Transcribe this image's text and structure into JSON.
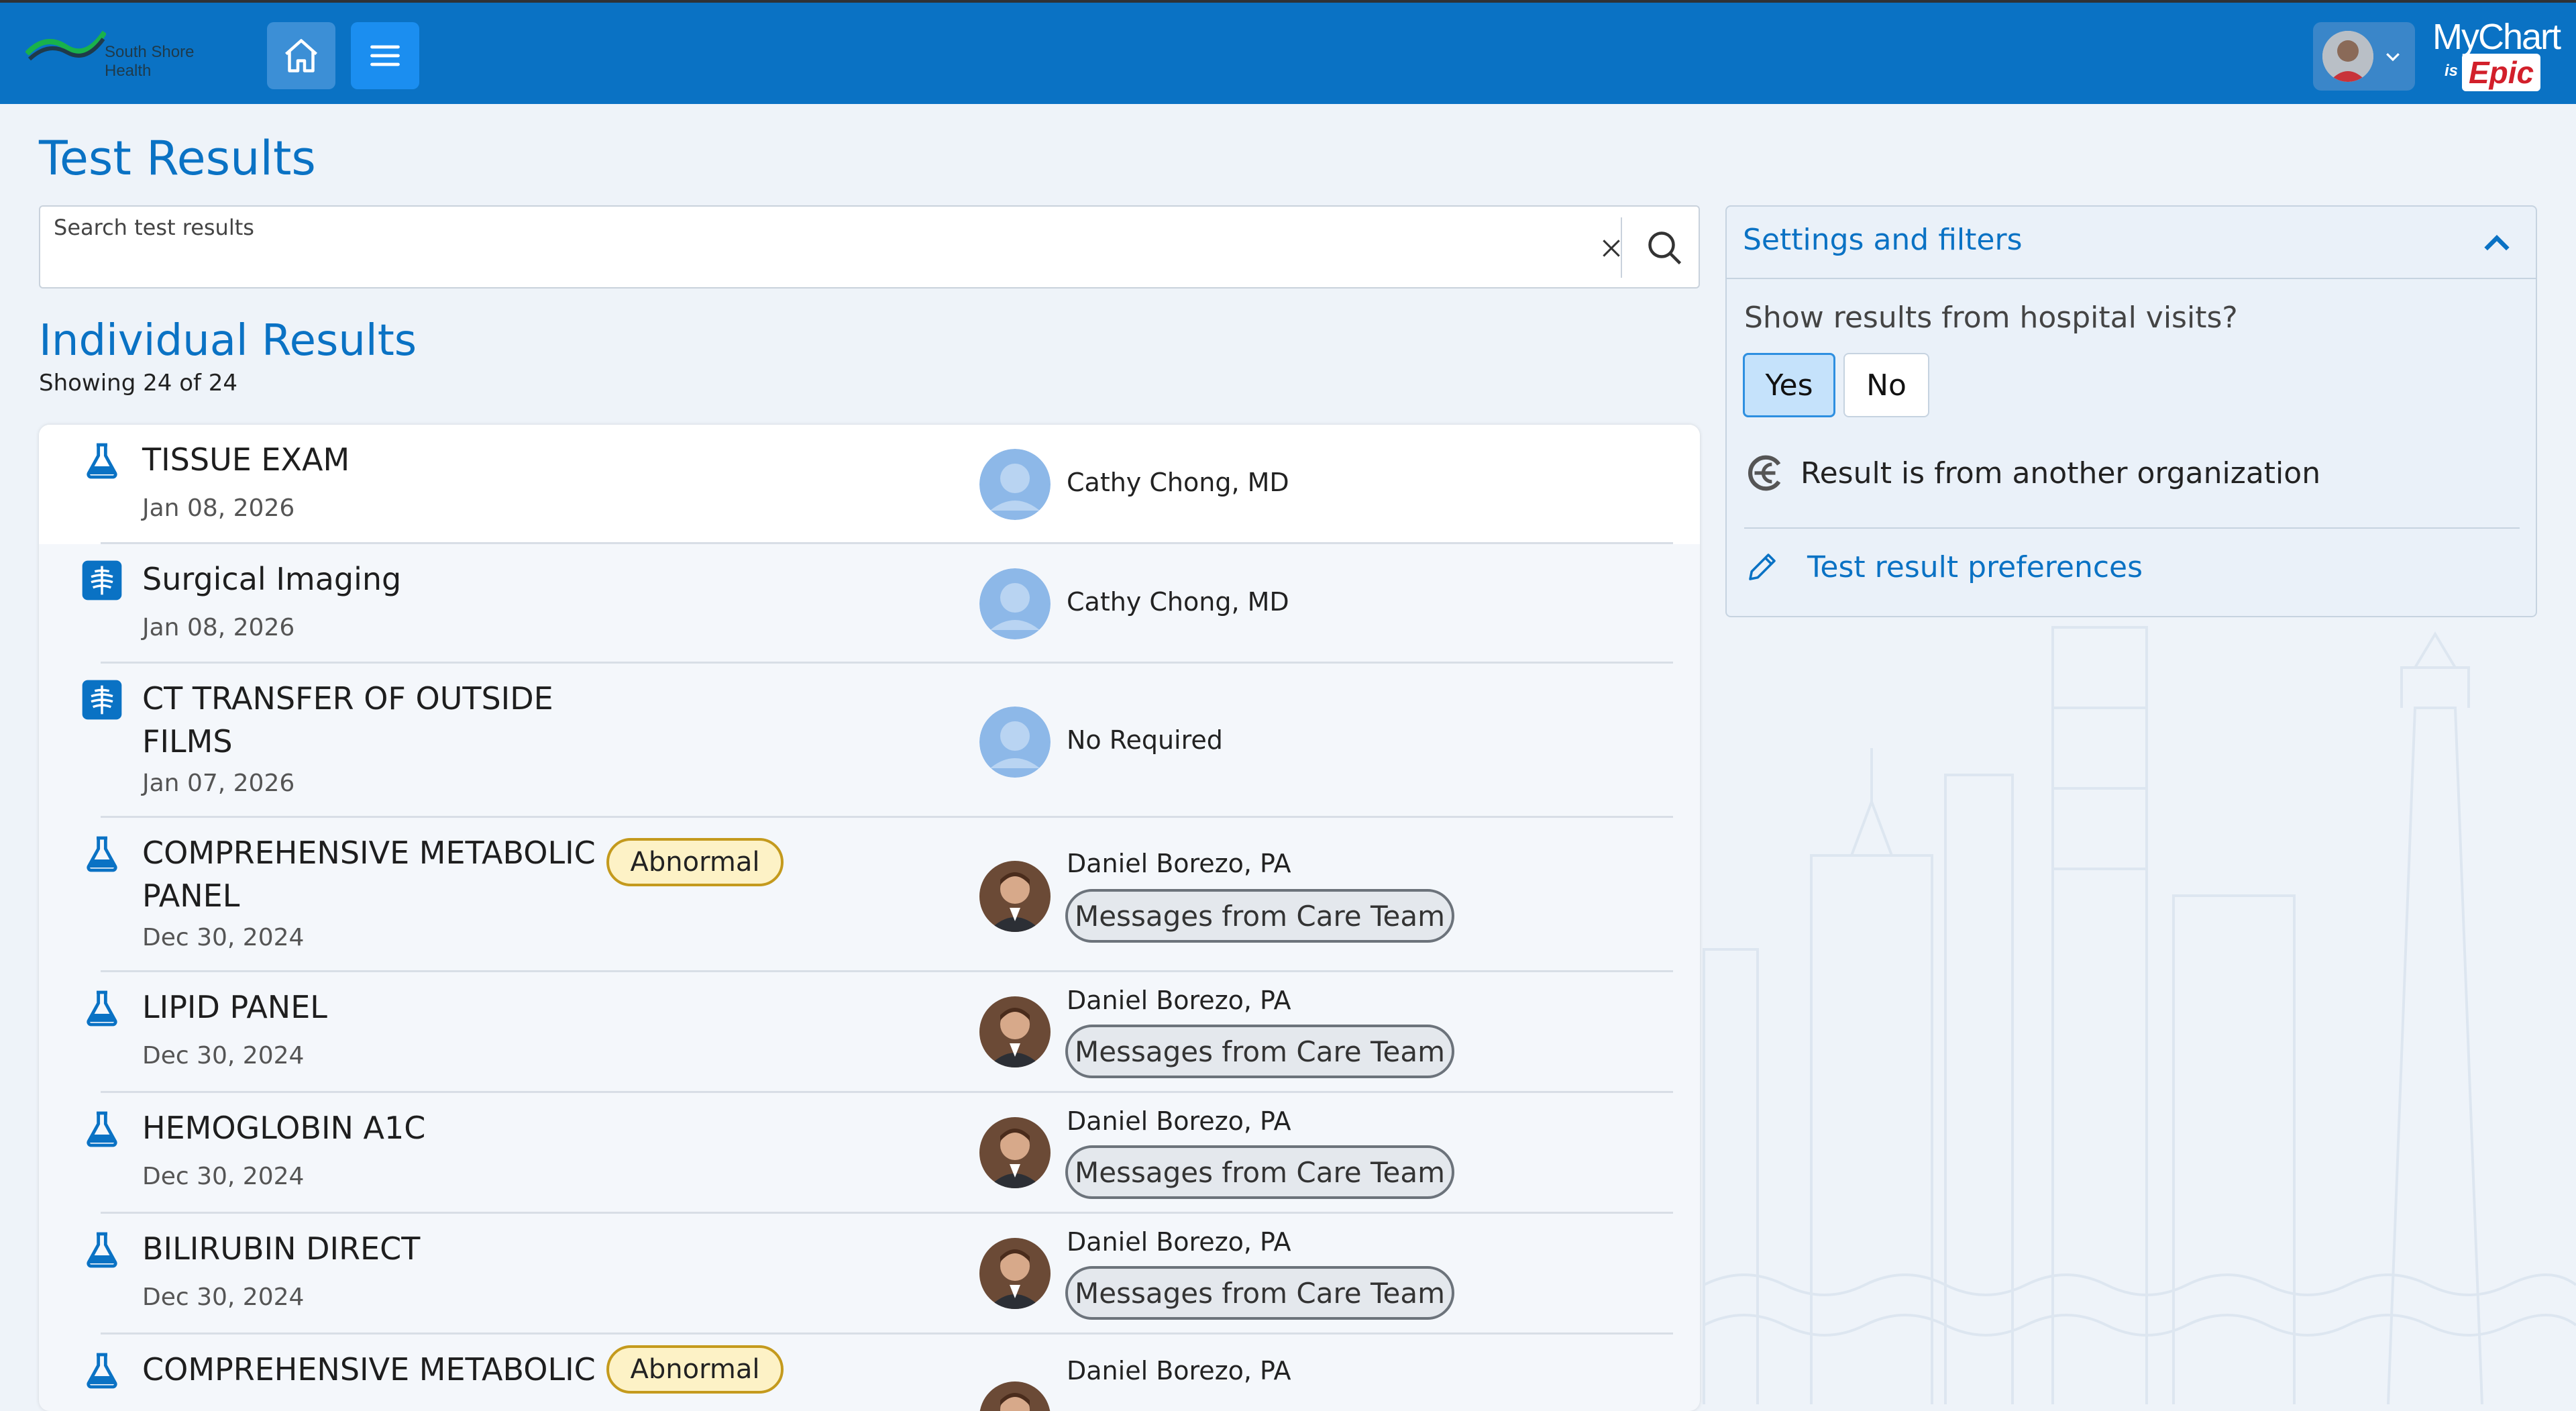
{
  "header": {
    "logo_text_line1": "South Shore",
    "logo_text_line2": "Health",
    "brand_mychart": "MyChart",
    "brand_is": "is",
    "brand_epic": "Epic"
  },
  "page": {
    "title": "Test Results",
    "search_placeholder": "Search test results",
    "section_title": "Individual Results",
    "showing": "Showing 24 of 24"
  },
  "results": [
    {
      "icon": "flask-icon",
      "name": "TISSUE EXAM",
      "date": "Jan 08, 2026",
      "abnormal": "",
      "provider": "Cathy Chong, MD",
      "provider_photo": "placeholder",
      "messages": ""
    },
    {
      "icon": "xray-icon",
      "name": "Surgical Imaging",
      "date": "Jan 08, 2026",
      "abnormal": "",
      "provider": "Cathy Chong, MD",
      "provider_photo": "placeholder",
      "messages": ""
    },
    {
      "icon": "xray-icon",
      "name": "CT TRANSFER OF OUTSIDE FILMS",
      "date": "Jan 07, 2026",
      "abnormal": "",
      "provider": "No Required",
      "provider_photo": "placeholder",
      "messages": ""
    },
    {
      "icon": "flask-icon",
      "name": "COMPREHENSIVE METABOLIC PANEL",
      "date": "Dec 30, 2024",
      "abnormal": "Abnormal",
      "provider": "Daniel Borezo, PA",
      "provider_photo": "photo",
      "messages": "Messages from Care Team"
    },
    {
      "icon": "flask-icon",
      "name": "LIPID PANEL",
      "date": "Dec 30, 2024",
      "abnormal": "",
      "provider": "Daniel Borezo, PA",
      "provider_photo": "photo",
      "messages": "Messages from Care Team"
    },
    {
      "icon": "flask-icon",
      "name": "HEMOGLOBIN A1C",
      "date": "Dec 30, 2024",
      "abnormal": "",
      "provider": "Daniel Borezo, PA",
      "provider_photo": "photo",
      "messages": "Messages from Care Team"
    },
    {
      "icon": "flask-icon",
      "name": "BILIRUBIN DIRECT",
      "date": "Dec 30, 2024",
      "abnormal": "",
      "provider": "Daniel Borezo, PA",
      "provider_photo": "photo",
      "messages": "Messages from Care Team"
    },
    {
      "icon": "flask-icon",
      "name": "COMPREHENSIVE METABOLIC",
      "date": "",
      "abnormal": "Abnormal",
      "provider": "Daniel Borezo, PA",
      "provider_photo": "photo",
      "messages": ""
    }
  ],
  "settings": {
    "title": "Settings and filters",
    "question": "Show results from hospital visits?",
    "yes_label": "Yes",
    "no_label": "No",
    "selected": "Yes",
    "other_org_label": "Result is from another organization",
    "preferences_label": "Test result preferences"
  },
  "colors": {
    "header_blue": "#0a72c4",
    "link_blue": "#0a72c4",
    "abnormal_fill": "#fdf2c6",
    "abnormal_border": "#c49a1d"
  }
}
